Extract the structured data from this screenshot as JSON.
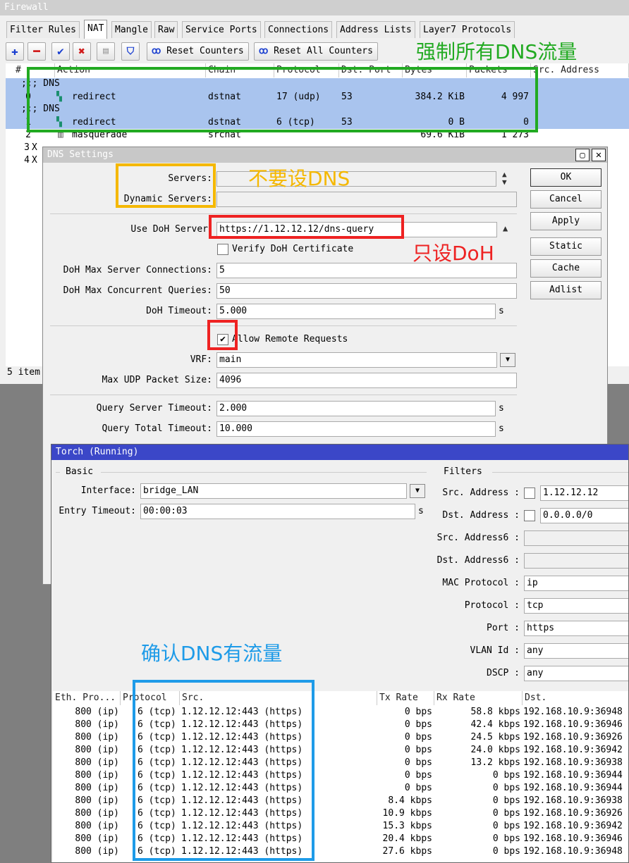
{
  "firewall": {
    "title": "Firewall",
    "tabs": [
      "Filter Rules",
      "NAT",
      "Mangle",
      "Raw",
      "Service Ports",
      "Connections",
      "Address Lists",
      "Layer7 Protocols"
    ],
    "toolbar": {
      "reset_counters": "Reset Counters",
      "reset_all_counters": "Reset All Counters"
    },
    "columns": [
      "#",
      "Action",
      "Chain",
      "Protocol",
      "Dst. Port",
      "Bytes",
      "Packets",
      "Src. Address"
    ],
    "comment_label": ";;; DNS",
    "rows": [
      {
        "num": "0",
        "action": "redirect",
        "chain": "dstnat",
        "protocol": "17 (udp)",
        "dst_port": "53",
        "bytes": "384.2 KiB",
        "packets": "4 997"
      },
      {
        "num": "1",
        "action": "redirect",
        "chain": "dstnat",
        "protocol": "6 (tcp)",
        "dst_port": "53",
        "bytes": "0 B",
        "packets": "0"
      },
      {
        "num": "2",
        "action": "masquerade",
        "chain": "srcnat",
        "protocol": "",
        "dst_port": "",
        "bytes": "69.6 KiB",
        "packets": "1 273"
      },
      {
        "num": "3",
        "flag": "X"
      },
      {
        "num": "4",
        "flag": "X"
      }
    ],
    "status": "5 item"
  },
  "dns": {
    "title": "DNS Settings",
    "labels": {
      "servers": "Servers:",
      "dynamic_servers": "Dynamic Servers:",
      "use_doh_server": "Use DoH Server",
      "verify_doh": "Verify DoH Certificate",
      "doh_max_conn": "DoH Max Server Connections:",
      "doh_max_queries": "DoH Max Concurrent Queries:",
      "doh_timeout": "DoH Timeout:",
      "allow_remote": "Allow Remote Requests",
      "vrf": "VRF:",
      "max_udp": "Max UDP Packet Size:",
      "query_server_timeout": "Query Server Timeout:",
      "query_total_timeout": "Query Total Timeout:",
      "unit_s": "s"
    },
    "values": {
      "use_doh_server": "https://1.12.12.12/dns-query",
      "doh_max_conn": "5",
      "doh_max_queries": "50",
      "doh_timeout": "5.000",
      "vrf": "main",
      "max_udp": "4096",
      "query_server_timeout": "2.000",
      "query_total_timeout": "10.000"
    },
    "buttons": [
      "OK",
      "Cancel",
      "Apply",
      "Static",
      "Cache",
      "Adlist"
    ]
  },
  "torch": {
    "title": "Torch (Running)",
    "basic_label": "Basic",
    "filters_label": "Filters",
    "labels": {
      "interface": "Interface:",
      "entry_timeout": "Entry Timeout:",
      "src_address": "Src. Address :",
      "dst_address": "Dst. Address :",
      "src_address6": "Src. Address6 :",
      "dst_address6": "Dst. Address6 :",
      "mac_protocol": "MAC Protocol :",
      "protocol": "Protocol :",
      "port": "Port :",
      "vlan_id": "VLAN Id :",
      "dscp": "DSCP :",
      "unit_s": "s"
    },
    "values": {
      "interface": "bridge_LAN",
      "entry_timeout": "00:00:03",
      "src_address": "1.12.12.12",
      "dst_address": "0.0.0.0/0",
      "mac_protocol": "ip",
      "protocol": "tcp",
      "port": "https",
      "vlan_id": "any",
      "dscp": "any"
    },
    "columns": [
      "Eth. Pro...",
      "Protocol",
      "Src.",
      "Tx Rate",
      "Rx Rate",
      "Dst."
    ],
    "rows": [
      {
        "eth": "800 (ip)",
        "proto": "6 (tcp)",
        "src": "1.12.12.12:443 (https)",
        "tx": "0 bps",
        "rx": "58.8 kbps",
        "dst": "192.168.10.9:36948"
      },
      {
        "eth": "800 (ip)",
        "proto": "6 (tcp)",
        "src": "1.12.12.12:443 (https)",
        "tx": "0 bps",
        "rx": "42.4 kbps",
        "dst": "192.168.10.9:36946"
      },
      {
        "eth": "800 (ip)",
        "proto": "6 (tcp)",
        "src": "1.12.12.12:443 (https)",
        "tx": "0 bps",
        "rx": "24.5 kbps",
        "dst": "192.168.10.9:36926"
      },
      {
        "eth": "800 (ip)",
        "proto": "6 (tcp)",
        "src": "1.12.12.12:443 (https)",
        "tx": "0 bps",
        "rx": "24.0 kbps",
        "dst": "192.168.10.9:36942"
      },
      {
        "eth": "800 (ip)",
        "proto": "6 (tcp)",
        "src": "1.12.12.12:443 (https)",
        "tx": "0 bps",
        "rx": "13.2 kbps",
        "dst": "192.168.10.9:36938"
      },
      {
        "eth": "800 (ip)",
        "proto": "6 (tcp)",
        "src": "1.12.12.12:443 (https)",
        "tx": "0 bps",
        "rx": "0 bps",
        "dst": "192.168.10.9:36944"
      },
      {
        "eth": "800 (ip)",
        "proto": "6 (tcp)",
        "src": "1.12.12.12:443 (https)",
        "tx": "0 bps",
        "rx": "0 bps",
        "dst": "192.168.10.9:36944"
      },
      {
        "eth": "800 (ip)",
        "proto": "6 (tcp)",
        "src": "1.12.12.12:443 (https)",
        "tx": "8.4 kbps",
        "rx": "0 bps",
        "dst": "192.168.10.9:36938"
      },
      {
        "eth": "800 (ip)",
        "proto": "6 (tcp)",
        "src": "1.12.12.12:443 (https)",
        "tx": "10.9 kbps",
        "rx": "0 bps",
        "dst": "192.168.10.9:36926"
      },
      {
        "eth": "800 (ip)",
        "proto": "6 (tcp)",
        "src": "1.12.12.12:443 (https)",
        "tx": "15.3 kbps",
        "rx": "0 bps",
        "dst": "192.168.10.9:36942"
      },
      {
        "eth": "800 (ip)",
        "proto": "6 (tcp)",
        "src": "1.12.12.12:443 (https)",
        "tx": "20.4 kbps",
        "rx": "0 bps",
        "dst": "192.168.10.9:36946"
      },
      {
        "eth": "800 (ip)",
        "proto": "6 (tcp)",
        "src": "1.12.12.12:443 (https)",
        "tx": "27.6 kbps",
        "rx": "0 bps",
        "dst": "192.168.10.9:36948"
      }
    ]
  },
  "annotations": {
    "force_dns": "强制所有DNS流量",
    "no_dns": "不要设DNS",
    "only_doh": "只设DoH",
    "confirm_dns": "确认DNS有流量"
  },
  "colors": {
    "green": "#22aa22",
    "orange": "#f5b800",
    "red": "#ee2222",
    "blue": "#1e9be8",
    "selected_row": "#a9c4ee",
    "torch_title": "#3b47c8"
  }
}
